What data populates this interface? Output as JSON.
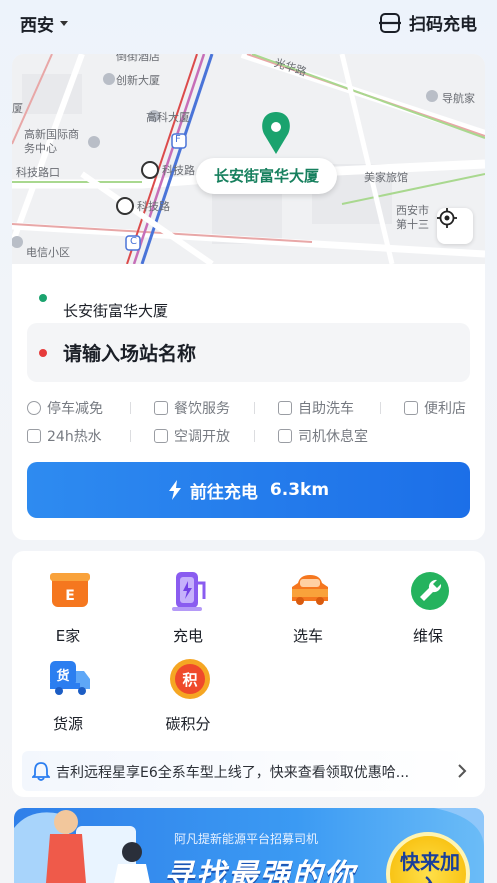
{
  "header": {
    "city": "西安",
    "scan_label": "扫码充电"
  },
  "map": {
    "pin_label": "长安街富华大厦",
    "labels": [
      "创新大厦",
      "高科大厦",
      "光华路",
      "导航家",
      "高新国际商务中心",
      "科技路口",
      "科技路",
      "科技路",
      "美家旅馆",
      "西安市第十三",
      "电信小区",
      "F",
      "C",
      "厦",
      "倒街酒店"
    ]
  },
  "route": {
    "from": "长安街富华大厦",
    "to_placeholder": "请输入场站名称"
  },
  "amenities": [
    {
      "icon": "parking-icon",
      "label": "停车减免"
    },
    {
      "icon": "dining-icon",
      "label": "餐饮服务"
    },
    {
      "icon": "car-wash-icon",
      "label": "自助洗车"
    },
    {
      "icon": "store-icon",
      "label": "便利店"
    },
    {
      "icon": "hot-water-icon",
      "label": "24h热水"
    },
    {
      "icon": "air-conditioning-icon",
      "label": "空调开放"
    },
    {
      "icon": "driver-lounge-icon",
      "label": "司机休息室"
    }
  ],
  "go_button": {
    "label": "前往充电",
    "distance": "6.3km"
  },
  "services": [
    {
      "icon": "e-home-icon",
      "label": "E家",
      "badge": "E"
    },
    {
      "icon": "charging-station-icon",
      "label": "充电"
    },
    {
      "icon": "car-select-icon",
      "label": "选车"
    },
    {
      "icon": "wrench-icon",
      "label": "维保"
    },
    {
      "icon": "cargo-truck-icon",
      "label": "货源",
      "badge": "货"
    },
    {
      "icon": "carbon-points-icon",
      "label": "碳积分",
      "badge": "积"
    }
  ],
  "notice": {
    "text": "吉利远程星享E6全系车型上线了，快来查看领取优惠哈..."
  },
  "banner": {
    "subtitle": "阿凡提新能源平台招募司机",
    "headline": "寻找最强的你",
    "cta": "快来加入"
  },
  "colors": {
    "primary": "#1c6fe8",
    "green": "#1aa36e",
    "red": "#e63b3b"
  }
}
